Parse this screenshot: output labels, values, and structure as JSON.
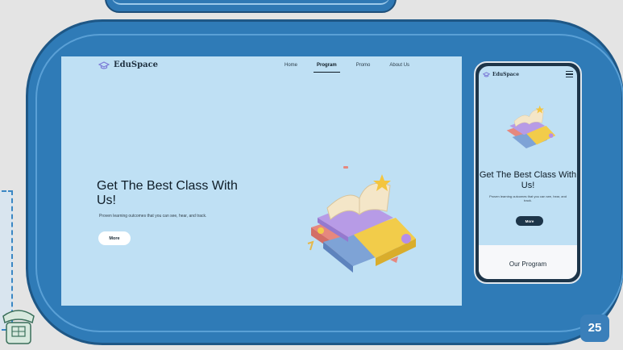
{
  "desktop": {
    "logo": "EduSpace",
    "nav": [
      {
        "label": "Home"
      },
      {
        "label": "Program",
        "active": true
      },
      {
        "label": "Promo"
      },
      {
        "label": "About Us"
      }
    ],
    "hero_title": "Get The Best Class With Us!",
    "hero_subtitle": "Proven learning outcomes that you can see, hear, and track.",
    "more_button": "More"
  },
  "mobile": {
    "logo": "EduSpace",
    "hero_title": "Get The Best Class With Us!",
    "hero_subtitle": "Proven learning outcomes that you can see, hear, and track.",
    "more_button": "More",
    "section_title": "Our Program"
  },
  "slide": {
    "page_number": "25"
  },
  "icons": [
    "graduation-cap-icon",
    "hamburger-menu-icon",
    "books-illustration",
    "telephone-icon"
  ],
  "colors": {
    "frame": "#2f7bb7",
    "hero_bg": "#bfe0f4",
    "dark": "#1d3549"
  }
}
